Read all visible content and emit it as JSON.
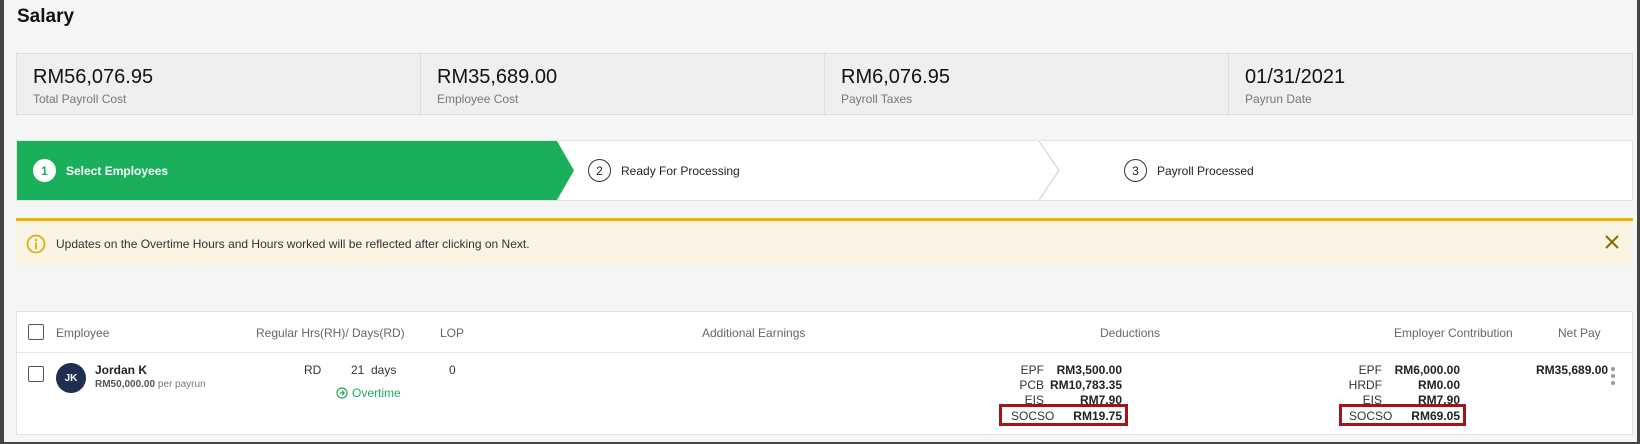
{
  "page": {
    "title": "Salary"
  },
  "stats": [
    {
      "value": "RM56,076.95",
      "label": "Total Payroll Cost"
    },
    {
      "value": "RM35,689.00",
      "label": "Employee Cost"
    },
    {
      "value": "RM6,076.95",
      "label": "Payroll Taxes"
    },
    {
      "value": "01/31/2021",
      "label": "Payrun Date"
    }
  ],
  "stepper": {
    "steps": [
      {
        "number": "1",
        "label": "Select Employees",
        "active": true
      },
      {
        "number": "2",
        "label": "Ready For Processing",
        "active": false
      },
      {
        "number": "3",
        "label": "Payroll Processed",
        "active": false
      }
    ]
  },
  "alert": {
    "text": "Updates on the Overtime Hours and Hours worked will be reflected after clicking on Next.",
    "icon": "info-icon",
    "close_icon": "close-icon"
  },
  "table": {
    "headers": {
      "employee": "Employee",
      "regular_hrs": "Regular Hrs(RH)/ Days(RD)",
      "lop": "LOP",
      "additional_earnings": "Additional Earnings",
      "deductions": "Deductions",
      "employer_contribution": "Employer Contribution",
      "net_pay": "Net Pay"
    },
    "rows": [
      {
        "initials": "JK",
        "name": "Jordan K",
        "salary": "RM50,000.00",
        "salary_suffix": "per payrun",
        "rd_label": "RD",
        "days": "21",
        "days_unit": "days",
        "overtime": "Overtime",
        "lop": "0",
        "deductions": [
          {
            "label": "EPF",
            "value": "RM3,500.00"
          },
          {
            "label": "PCB",
            "value": "RM10,783.35"
          },
          {
            "label": "EIS",
            "value": "RM7.90"
          },
          {
            "label": "SOCSO",
            "value": "RM19.75"
          }
        ],
        "employer_contribution": [
          {
            "label": "EPF",
            "value": "RM6,000.00"
          },
          {
            "label": "HRDF",
            "value": "RM0.00"
          },
          {
            "label": "EIS",
            "value": "RM7.90"
          },
          {
            "label": "SOCSO",
            "value": "RM69.05"
          }
        ],
        "net_pay": "RM35,689.00"
      }
    ]
  },
  "colors": {
    "accent_green": "#1baf5b",
    "alert_border": "#f0b400",
    "alert_bg": "#f8f3e2",
    "highlight_red": "#a5121a",
    "avatar_navy": "#1e2f52"
  }
}
